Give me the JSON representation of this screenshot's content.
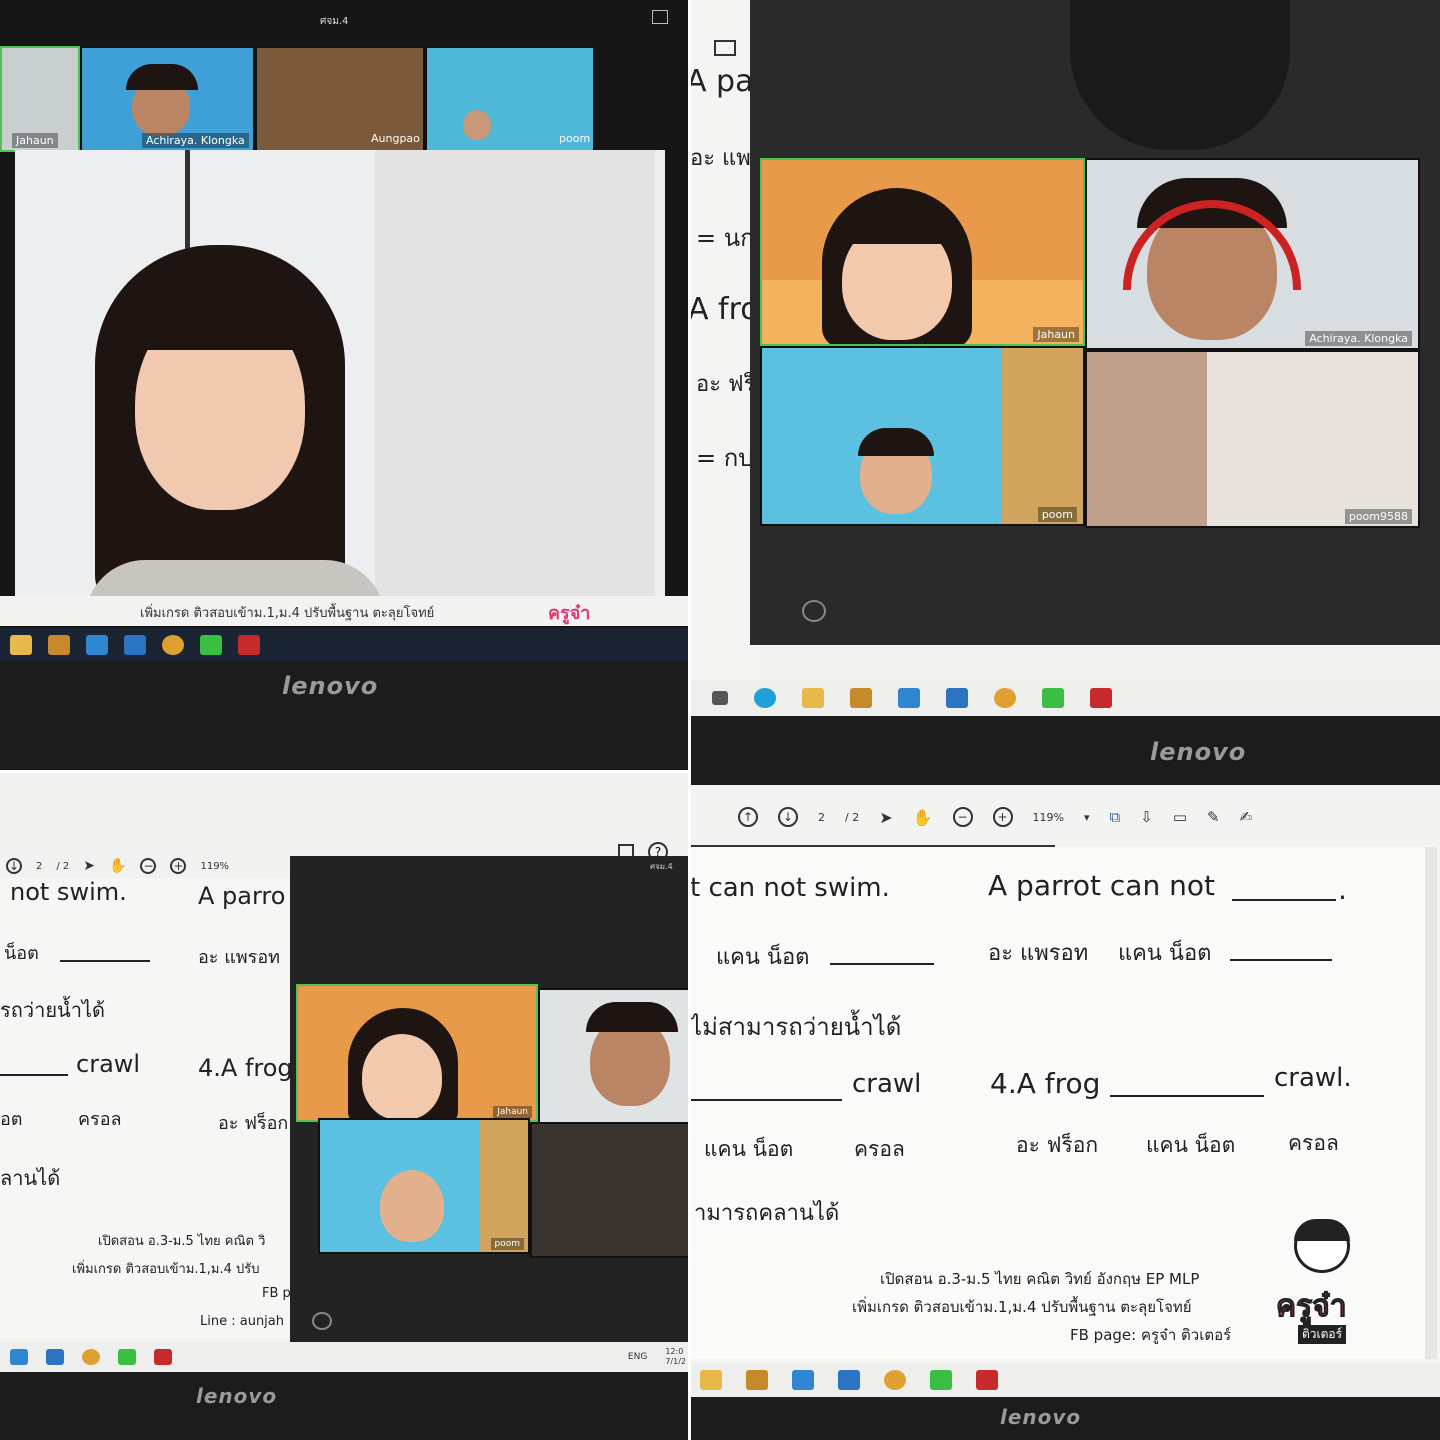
{
  "meeting": {
    "window_title": "ศจม.4",
    "participants": {
      "jahaun": "Jahaun",
      "achiraya": "Achiraya.  Klongka",
      "aungpao": "Aungpao",
      "poom": "poom",
      "poom9588": "poom9588"
    }
  },
  "ad": {
    "line1": "เปิดสอน อ.3-ม.5 ไทย คณิต วิทย์ อังกฤษ EP MLP",
    "line2": "เพิ่มเกรด ติวสอบเข้าม.1,ม.4 ปรับพื้นฐาน ตะลุยโจทย์",
    "line3": "FB page: ครูจ๋า ติวเตอร์",
    "line3_short": "FB p",
    "line4": "Line : aunjah",
    "line1_short": "เปิดสอน อ.3-ม.5 ไทย คณิต วิ",
    "line2_short": "เพิ่มเกรด ติวสอบเข้าม.1,ม.4 ปรับ",
    "logo_text": "ครูจ๋า",
    "logo_sub": "ติวเตอร์",
    "logo_partial": "ครูจ๋า"
  },
  "laptop": {
    "brand": "lenovo"
  },
  "pdf_toolbar": {
    "page": "2",
    "pages": "/ 2",
    "zoom": "119%"
  },
  "worksheet": {
    "q3_end": "t can not swim.",
    "q3_end_left": "not swim.",
    "q3_read": "แคน น็อต",
    "q3_read_left": "น็อต",
    "q3_mean": "ไม่สามารถว่ายน้ำได้",
    "q3_mean_left": "รถว่ายน้ำได้",
    "q2_text": "A parrot can not",
    "q2_partial": "A parro",
    "q2_read_a": "อะ  แพรอท",
    "q2_read_b": "แคน น็อต",
    "q2_read_partial": "อะ  แพรอท",
    "crawl": "crawl",
    "crawl_dot": "crawl.",
    "q4_text": "4.A frog",
    "q4_partial": "4.A frog",
    "q4_read_a": "อะ ฟร็อก",
    "q4_read_b": "แคน น็อต",
    "q4_read_c": "ครอล",
    "q4_read_partial": "อะ ฟร็อก",
    "crawl_read_left": "อต",
    "crawl_read": "ครอล",
    "crawl_can_not": "แคน น็อต",
    "crawl_mean": "ามารถคลานได้",
    "crawl_mean_left": "ลานได้",
    "left_top_partial": "A pa",
    "left_read_partial": "อะ  แพ",
    "left_eq1": "= นก",
    "left_frog_partial": "A fro",
    "left_frog_read": "อะ ฟร็",
    "left_eq2": "= กบไ"
  },
  "system_tray": {
    "lang": "ENG",
    "time": "12:0",
    "date": "7/1/2"
  },
  "colors": {
    "zoom_border": "#4ec44e",
    "taskbar": "#1e2a3a",
    "screen_bg": "#d9d9d6",
    "bezel": "#1c1c1c"
  }
}
